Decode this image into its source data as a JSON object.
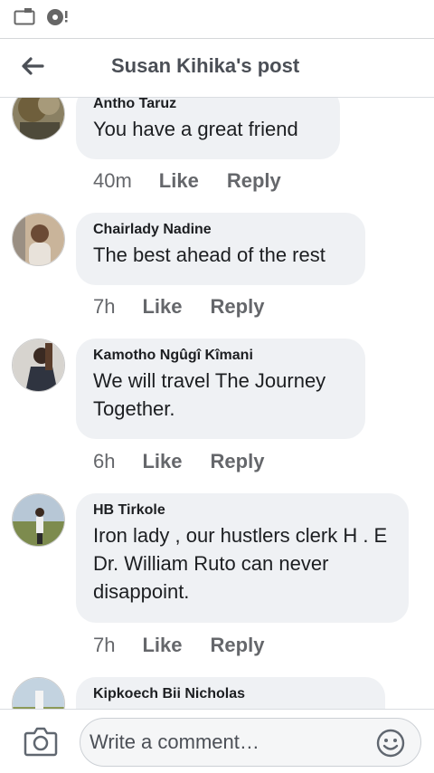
{
  "header": {
    "title": "Susan Kihika's post",
    "back_icon": "back-arrow-icon"
  },
  "status_bar": {
    "icons": [
      "sd-card-icon",
      "media-notification-icon"
    ]
  },
  "comments": [
    {
      "author": "Antho Taruz",
      "text": "You have a great friend",
      "time": "40m",
      "like": "Like",
      "reply": "Reply"
    },
    {
      "author": "Chairlady Nadine",
      "text": "The best ahead of the rest",
      "time": "7h",
      "like": "Like",
      "reply": "Reply"
    },
    {
      "author": "Kamotho Ngûgî Kîmani",
      "text": "We will travel The Journey Together.",
      "time": "6h",
      "like": "Like",
      "reply": "Reply"
    },
    {
      "author": "HB Tirkole",
      "text": "Iron lady , our hustlers clerk H . E Dr. William Ruto can never disappoint.",
      "time": "7h",
      "like": "Like",
      "reply": "Reply"
    },
    {
      "author": "Kipkoech Bii Nicholas",
      "text": "",
      "time": "",
      "like": "",
      "reply": ""
    }
  ],
  "composer": {
    "placeholder": "Write a comment…",
    "camera_icon": "camera-icon",
    "emoji_icon": "emoji-icon"
  },
  "colors": {
    "bubble": "#eff1f4",
    "meta_text": "#65676b",
    "title_text": "#4b4f56"
  }
}
